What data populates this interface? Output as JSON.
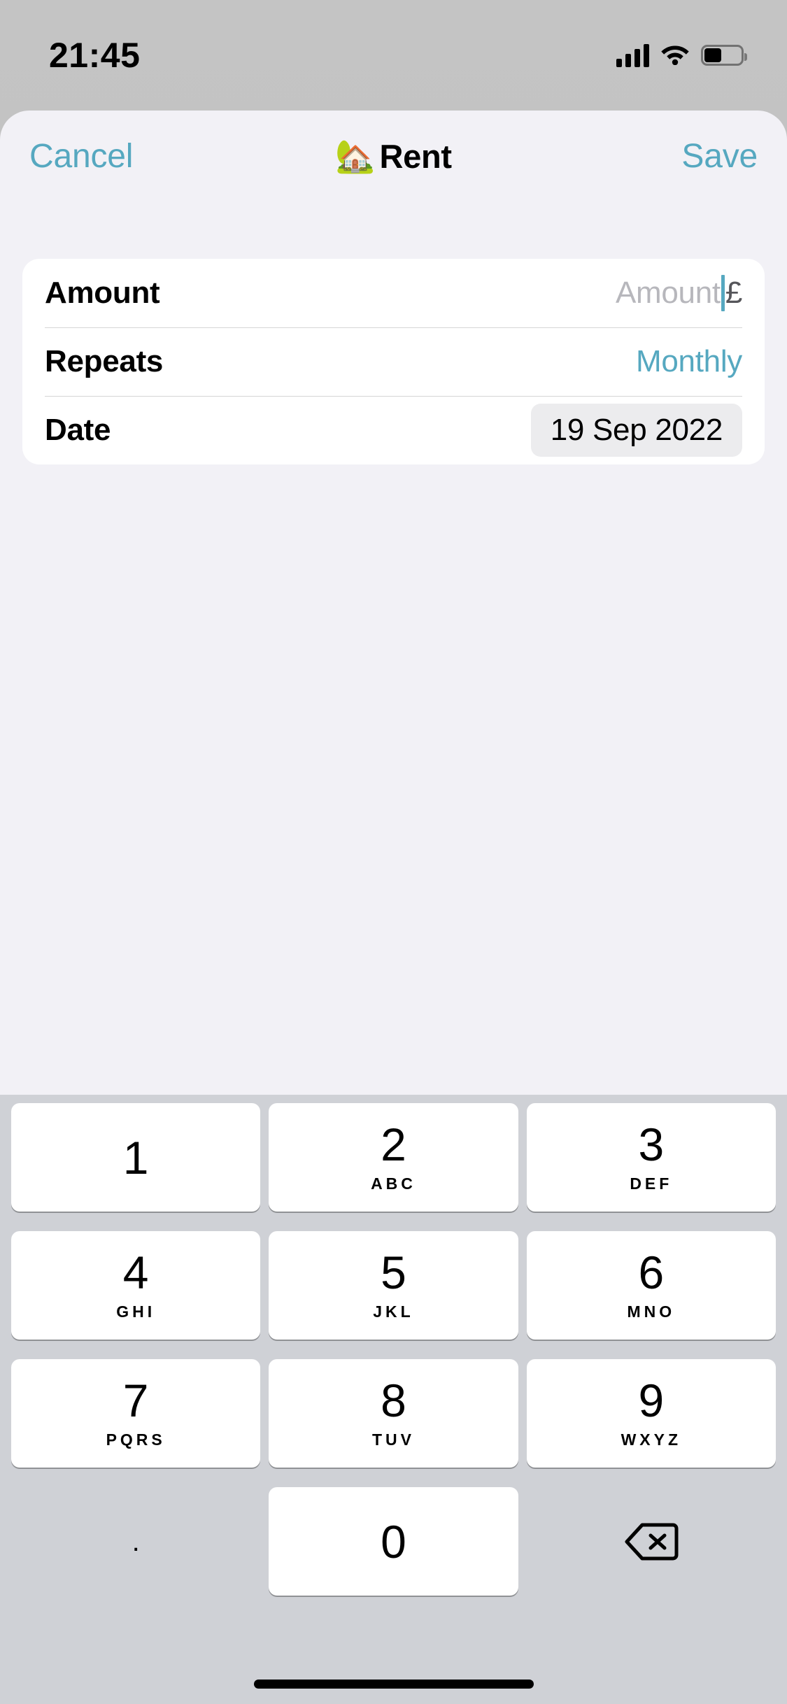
{
  "status_bar": {
    "time": "21:45",
    "cellular_icon": "cellular-signal-icon",
    "wifi_icon": "wifi-icon",
    "battery_icon": "battery-icon"
  },
  "nav_bar": {
    "cancel_label": "Cancel",
    "title_emoji": "🏡",
    "title": "Rent",
    "save_label": "Save"
  },
  "form": {
    "rows": [
      {
        "label": "Amount",
        "type": "text-input",
        "value": "",
        "placeholder": "Amount",
        "currency": "£"
      },
      {
        "label": "Repeats",
        "type": "select",
        "value": "Monthly"
      },
      {
        "label": "Date",
        "type": "date-pill",
        "value": "19 Sep 2022"
      }
    ]
  },
  "keyboard": {
    "type": "numeric-pad",
    "rows": [
      [
        {
          "digit": "1",
          "letters": ""
        },
        {
          "digit": "2",
          "letters": "ABC"
        },
        {
          "digit": "3",
          "letters": "DEF"
        }
      ],
      [
        {
          "digit": "4",
          "letters": "GHI"
        },
        {
          "digit": "5",
          "letters": "JKL"
        },
        {
          "digit": "6",
          "letters": "MNO"
        }
      ],
      [
        {
          "digit": "7",
          "letters": "PQRS"
        },
        {
          "digit": "8",
          "letters": "TUV"
        },
        {
          "digit": "9",
          "letters": "WXYZ"
        }
      ],
      [
        {
          "digit": ".",
          "letters": ""
        },
        {
          "digit": "0",
          "letters": ""
        },
        {
          "digit": "",
          "letters": "",
          "icon": "delete-backward-icon"
        }
      ]
    ]
  },
  "colors": {
    "accent_teal": "#56A8C0",
    "sheet_background": "#F2F1F6",
    "card_background": "#FFFFFF",
    "keyboard_background": "#CFD1D6",
    "date_pill_background": "#ECECEE",
    "placeholder_grey": "#B7B7BC"
  }
}
